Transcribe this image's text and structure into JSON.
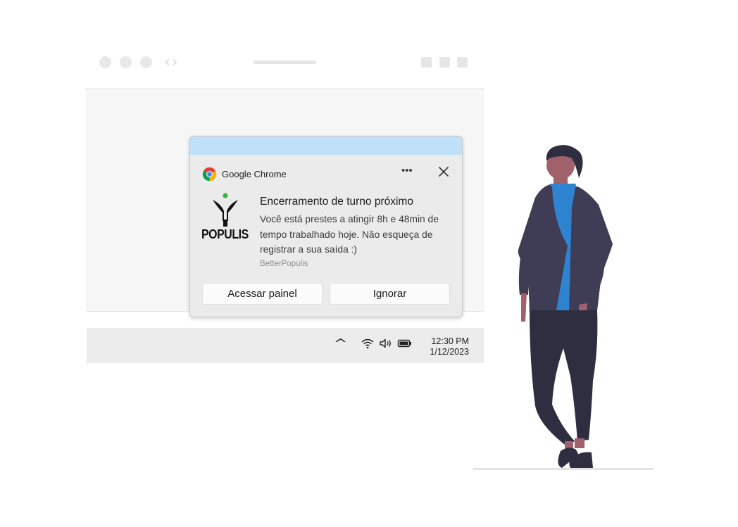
{
  "notification": {
    "app_name": "Google Chrome",
    "more_label": "•••",
    "logo_text": "POPULIS",
    "title": "Encerramento de turno próximo",
    "body": "Você está prestes a atingir 8h e 48min de tempo trabalhado hoje. Não esqueça de registrar a sua saída :)",
    "source": "BetterPopulis",
    "actions": [
      "Acessar painel",
      "Ignorar"
    ],
    "accent_color": "#bfe1f7"
  },
  "browser": {
    "nav_arrows": "‹›"
  },
  "taskbar": {
    "tray_caret": "^",
    "time": "12:30 PM",
    "date": "1/12/2023",
    "icons": [
      "wifi-icon",
      "volume-icon",
      "battery-icon"
    ]
  },
  "illustration": {
    "subject": "person-standing",
    "colors": {
      "jacket": "#3f3d56",
      "shirt": "#2f84d1",
      "pants": "#2f2e41",
      "skin": "#a0616a",
      "hair": "#2f2e41"
    }
  }
}
